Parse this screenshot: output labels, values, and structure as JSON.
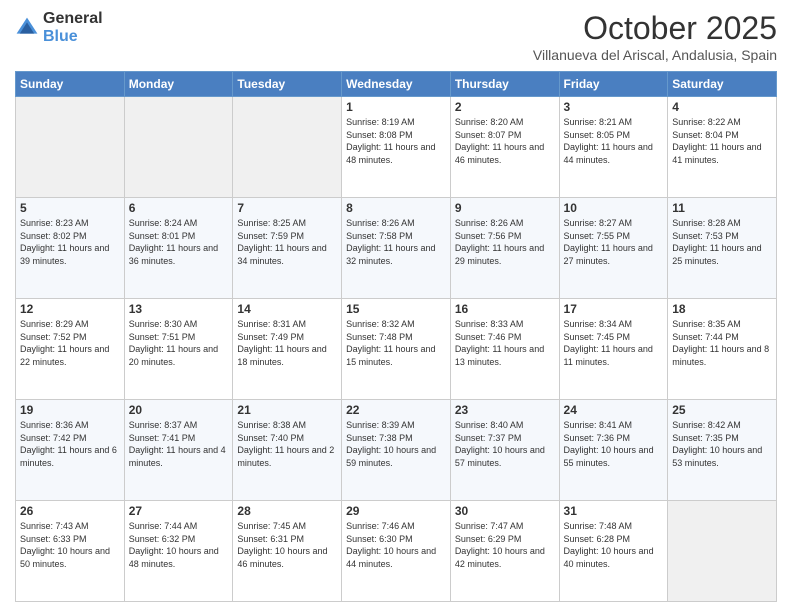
{
  "header": {
    "logo_line1": "General",
    "logo_line2": "Blue",
    "month": "October 2025",
    "location": "Villanueva del Ariscal, Andalusia, Spain"
  },
  "days_of_week": [
    "Sunday",
    "Monday",
    "Tuesday",
    "Wednesday",
    "Thursday",
    "Friday",
    "Saturday"
  ],
  "weeks": [
    [
      {
        "day": "",
        "info": ""
      },
      {
        "day": "",
        "info": ""
      },
      {
        "day": "",
        "info": ""
      },
      {
        "day": "1",
        "info": "Sunrise: 8:19 AM\nSunset: 8:08 PM\nDaylight: 11 hours and 48 minutes."
      },
      {
        "day": "2",
        "info": "Sunrise: 8:20 AM\nSunset: 8:07 PM\nDaylight: 11 hours and 46 minutes."
      },
      {
        "day": "3",
        "info": "Sunrise: 8:21 AM\nSunset: 8:05 PM\nDaylight: 11 hours and 44 minutes."
      },
      {
        "day": "4",
        "info": "Sunrise: 8:22 AM\nSunset: 8:04 PM\nDaylight: 11 hours and 41 minutes."
      }
    ],
    [
      {
        "day": "5",
        "info": "Sunrise: 8:23 AM\nSunset: 8:02 PM\nDaylight: 11 hours and 39 minutes."
      },
      {
        "day": "6",
        "info": "Sunrise: 8:24 AM\nSunset: 8:01 PM\nDaylight: 11 hours and 36 minutes."
      },
      {
        "day": "7",
        "info": "Sunrise: 8:25 AM\nSunset: 7:59 PM\nDaylight: 11 hours and 34 minutes."
      },
      {
        "day": "8",
        "info": "Sunrise: 8:26 AM\nSunset: 7:58 PM\nDaylight: 11 hours and 32 minutes."
      },
      {
        "day": "9",
        "info": "Sunrise: 8:26 AM\nSunset: 7:56 PM\nDaylight: 11 hours and 29 minutes."
      },
      {
        "day": "10",
        "info": "Sunrise: 8:27 AM\nSunset: 7:55 PM\nDaylight: 11 hours and 27 minutes."
      },
      {
        "day": "11",
        "info": "Sunrise: 8:28 AM\nSunset: 7:53 PM\nDaylight: 11 hours and 25 minutes."
      }
    ],
    [
      {
        "day": "12",
        "info": "Sunrise: 8:29 AM\nSunset: 7:52 PM\nDaylight: 11 hours and 22 minutes."
      },
      {
        "day": "13",
        "info": "Sunrise: 8:30 AM\nSunset: 7:51 PM\nDaylight: 11 hours and 20 minutes."
      },
      {
        "day": "14",
        "info": "Sunrise: 8:31 AM\nSunset: 7:49 PM\nDaylight: 11 hours and 18 minutes."
      },
      {
        "day": "15",
        "info": "Sunrise: 8:32 AM\nSunset: 7:48 PM\nDaylight: 11 hours and 15 minutes."
      },
      {
        "day": "16",
        "info": "Sunrise: 8:33 AM\nSunset: 7:46 PM\nDaylight: 11 hours and 13 minutes."
      },
      {
        "day": "17",
        "info": "Sunrise: 8:34 AM\nSunset: 7:45 PM\nDaylight: 11 hours and 11 minutes."
      },
      {
        "day": "18",
        "info": "Sunrise: 8:35 AM\nSunset: 7:44 PM\nDaylight: 11 hours and 8 minutes."
      }
    ],
    [
      {
        "day": "19",
        "info": "Sunrise: 8:36 AM\nSunset: 7:42 PM\nDaylight: 11 hours and 6 minutes."
      },
      {
        "day": "20",
        "info": "Sunrise: 8:37 AM\nSunset: 7:41 PM\nDaylight: 11 hours and 4 minutes."
      },
      {
        "day": "21",
        "info": "Sunrise: 8:38 AM\nSunset: 7:40 PM\nDaylight: 11 hours and 2 minutes."
      },
      {
        "day": "22",
        "info": "Sunrise: 8:39 AM\nSunset: 7:38 PM\nDaylight: 10 hours and 59 minutes."
      },
      {
        "day": "23",
        "info": "Sunrise: 8:40 AM\nSunset: 7:37 PM\nDaylight: 10 hours and 57 minutes."
      },
      {
        "day": "24",
        "info": "Sunrise: 8:41 AM\nSunset: 7:36 PM\nDaylight: 10 hours and 55 minutes."
      },
      {
        "day": "25",
        "info": "Sunrise: 8:42 AM\nSunset: 7:35 PM\nDaylight: 10 hours and 53 minutes."
      }
    ],
    [
      {
        "day": "26",
        "info": "Sunrise: 7:43 AM\nSunset: 6:33 PM\nDaylight: 10 hours and 50 minutes."
      },
      {
        "day": "27",
        "info": "Sunrise: 7:44 AM\nSunset: 6:32 PM\nDaylight: 10 hours and 48 minutes."
      },
      {
        "day": "28",
        "info": "Sunrise: 7:45 AM\nSunset: 6:31 PM\nDaylight: 10 hours and 46 minutes."
      },
      {
        "day": "29",
        "info": "Sunrise: 7:46 AM\nSunset: 6:30 PM\nDaylight: 10 hours and 44 minutes."
      },
      {
        "day": "30",
        "info": "Sunrise: 7:47 AM\nSunset: 6:29 PM\nDaylight: 10 hours and 42 minutes."
      },
      {
        "day": "31",
        "info": "Sunrise: 7:48 AM\nSunset: 6:28 PM\nDaylight: 10 hours and 40 minutes."
      },
      {
        "day": "",
        "info": ""
      }
    ]
  ]
}
